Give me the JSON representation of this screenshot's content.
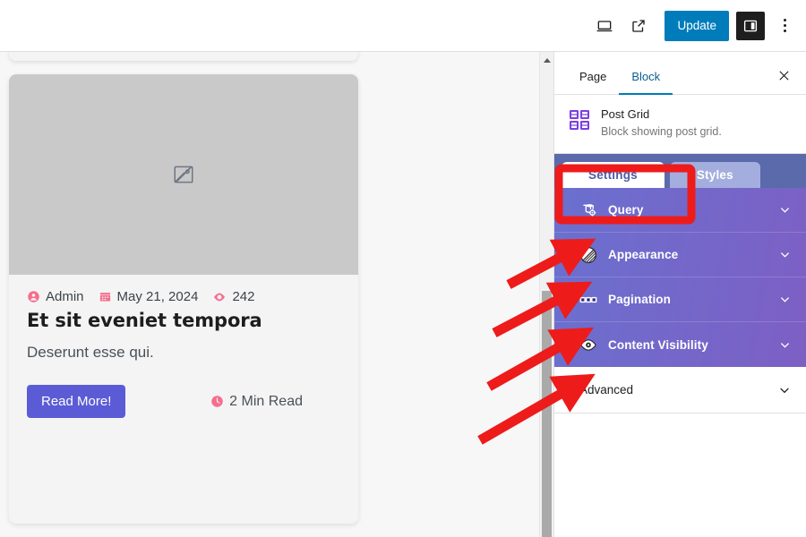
{
  "toolbar": {
    "device_preview_icon": "laptop-icon",
    "view_external_icon": "external-link-icon",
    "update_label": "Update",
    "sidebar_toggle_icon": "settings-sidebar-icon",
    "options_icon": "kebab-menu-icon"
  },
  "inspector": {
    "tabs": [
      {
        "label": "Page",
        "active": false
      },
      {
        "label": "Block",
        "active": true
      }
    ],
    "close_icon": "close-icon",
    "block": {
      "icon": "post-grid-icon",
      "name": "Post Grid",
      "description": "Block showing post grid."
    },
    "plugin_tabs": [
      {
        "label": "Settings",
        "active": true
      },
      {
        "label": "Styles",
        "active": false
      }
    ],
    "accordions": [
      {
        "label": "Query",
        "icon": "database-query-icon",
        "chevron": "chevron-down-icon"
      },
      {
        "label": "Appearance",
        "icon": "appearance-paint-icon",
        "chevron": "chevron-down-icon"
      },
      {
        "label": "Pagination",
        "icon": "pagination-dots-icon",
        "chevron": "chevron-down-icon"
      },
      {
        "label": "Content Visibility",
        "icon": "eye-icon",
        "chevron": "chevron-down-icon"
      }
    ],
    "advanced": {
      "label": "Advanced",
      "chevron": "chevron-down-icon"
    }
  },
  "canvas": {
    "post": {
      "thumbnail_icon": "broken-image-icon",
      "author_icon": "user-icon",
      "author": "Admin",
      "date_icon": "calendar-icon",
      "date": "May 21, 2024",
      "views_icon": "eye-icon",
      "views": "242",
      "title": "Et sit eveniet tempora",
      "excerpt": "Deserunt esse qui.",
      "read_more_label": "Read More!",
      "read_time_icon": "clock-icon",
      "read_time": "2 Min Read"
    }
  },
  "scrollbar": {
    "up_arrow_icon": "scroll-up-arrow-icon",
    "thumb": "scrollbar-thumb"
  },
  "annotations": {
    "highlight_box": "settings-tab-highlight",
    "arrow_count": 4,
    "color": "#ee1b1b"
  },
  "colors": {
    "accent_blue": "#007cba",
    "panel_gradient_from": "#6a70cf",
    "panel_gradient_to": "#7d5fc4",
    "tabbar_blue": "#5b6aab",
    "inactive_tab": "#a4aede",
    "meta_pink": "#f56e8d",
    "read_more_purple": "#5b5bd6",
    "annotation_red": "#ee1b1b"
  }
}
